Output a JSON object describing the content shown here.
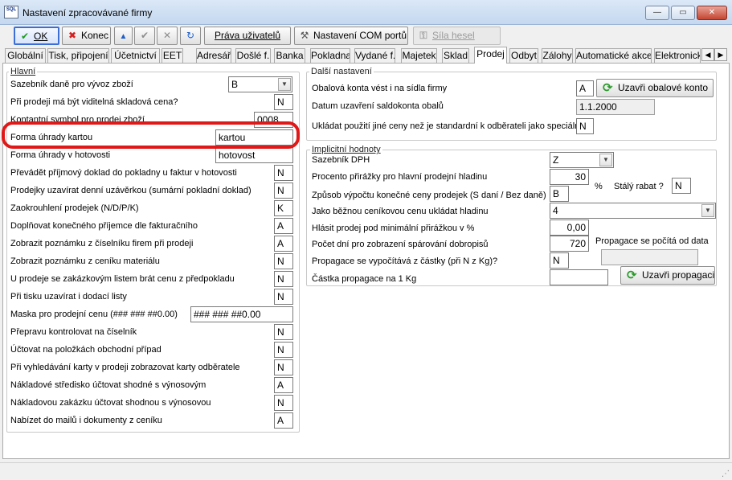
{
  "window": {
    "title": "Nastavení zpracovávané firmy",
    "logo_text": "SQL",
    "minimize": "—",
    "maximize": "▭",
    "close": "✕"
  },
  "toolbar": {
    "ok": "OK",
    "konec": "Konec",
    "prava": "Práva uživatelů",
    "com": "Nastavení COM portů",
    "sila": "Síla hesel"
  },
  "tabs": [
    "Globální",
    "Tisk, připojení",
    "Účetnictví",
    "EET",
    "Adresář",
    "Došlé f.",
    "Banka",
    "Pokladna",
    "Vydané f.",
    "Majetek",
    "Sklad",
    "Prodej",
    "Odbyt",
    "Zálohy",
    "Automatické akce",
    "Elektronick"
  ],
  "active_tab": "Prodej",
  "hlavni": {
    "title": "Hlavní",
    "rows": [
      {
        "label": "Sazebník daně pro vývoz zboží",
        "value": "B"
      },
      {
        "label": "Při prodeji má být viditelná skladová cena?",
        "value": "N"
      },
      {
        "label": "Kontantní symbol pro prodej zboží",
        "value": "0008"
      },
      {
        "label": "Forma úhrady kartou",
        "value": "kartou"
      },
      {
        "label": "Forma úhrady v hotovosti",
        "value": "hotovost"
      },
      {
        "label": "Převádět příjmový doklad do pokladny u faktur v hotovosti",
        "value": "N"
      },
      {
        "label": "Prodejky uzavírat denní uzávěrkou (sumární pokladní doklad)",
        "value": "N"
      },
      {
        "label": "Zaokrouhlení prodejek (N/D/P/K)",
        "value": "K"
      },
      {
        "label": "Doplňovat konečného příjemce dle fakturačního",
        "value": "A"
      },
      {
        "label": "Zobrazit poznámku z číselníku firem při prodeji",
        "value": "A"
      },
      {
        "label": "Zobrazit poznámku z ceníku materiálu",
        "value": "N"
      },
      {
        "label": "U prodeje se zakázkovým listem brát cenu z předpokladu",
        "value": "N"
      },
      {
        "label": "Při tisku uzavírat i dodací listy",
        "value": "N"
      },
      {
        "label": "Maska pro prodejní cenu (### ### ##0.00)",
        "value": "### ### ##0.00"
      },
      {
        "label": "Přepravu kontrolovat na číselník",
        "value": "N"
      },
      {
        "label": "Účtovat na položkách obchodní případ",
        "value": "N"
      },
      {
        "label": "Při vyhledávání karty v prodeji zobrazovat karty odběratele",
        "value": "N"
      },
      {
        "label": "Nákladové středisko účtovat shodné s výnosovým",
        "value": "A"
      },
      {
        "label": "Nákladovou zakázku účtovat shodnou s výnosovou",
        "value": "N"
      },
      {
        "label": "Nabízet do mailů i dokumenty z ceníku",
        "value": "A"
      }
    ]
  },
  "dalsi": {
    "title": "Další nastavení",
    "obal_label": "Obalová konta vést i na sídla firmy",
    "obal_value": "A",
    "obal_button": "Uzavři obalové konto",
    "datum_label": "Datum uzavření saldokonta obalů",
    "datum_value": "1.1.2000",
    "jine_label": "Ukládat použití jiné ceny než je standardní k odběrateli jako speciální",
    "jine_value": "N"
  },
  "implicitni": {
    "title": "Implicitní hodnoty",
    "sazebnik_label": "Sazebník DPH",
    "sazebnik_value": "Z",
    "procento_label": "Procento přirážky pro hlavní prodejní hladinu",
    "procento_value": "30",
    "percent_sign": "%",
    "stały_label": "Stálý rabat ?",
    "staly_value": "N",
    "zpusob_label": "Způsob výpočtu konečné ceny prodejek (S daní / Bez daně)",
    "zpusob_value": "B",
    "hladina_label": "Jako běžnou ceníkovou cenu ukládat hladinu",
    "hladina_value": "4",
    "hlasit_label": "Hlásit prodej pod minimální přirážkou v %",
    "hlasit_value": "0,00",
    "pocet_label": "Počet dní pro zobrazení spárování dobropisů",
    "pocet_value": "720",
    "propagace_note": "Propagace se počítá od data",
    "propagace_label": "Propagace se vypočítává z částky (při N z Kg)?",
    "propagace_value": "N",
    "castka_label": "Částka propagace na 1 Kg",
    "castka_value": "",
    "propagace_button": "Uzavři propagaci"
  }
}
